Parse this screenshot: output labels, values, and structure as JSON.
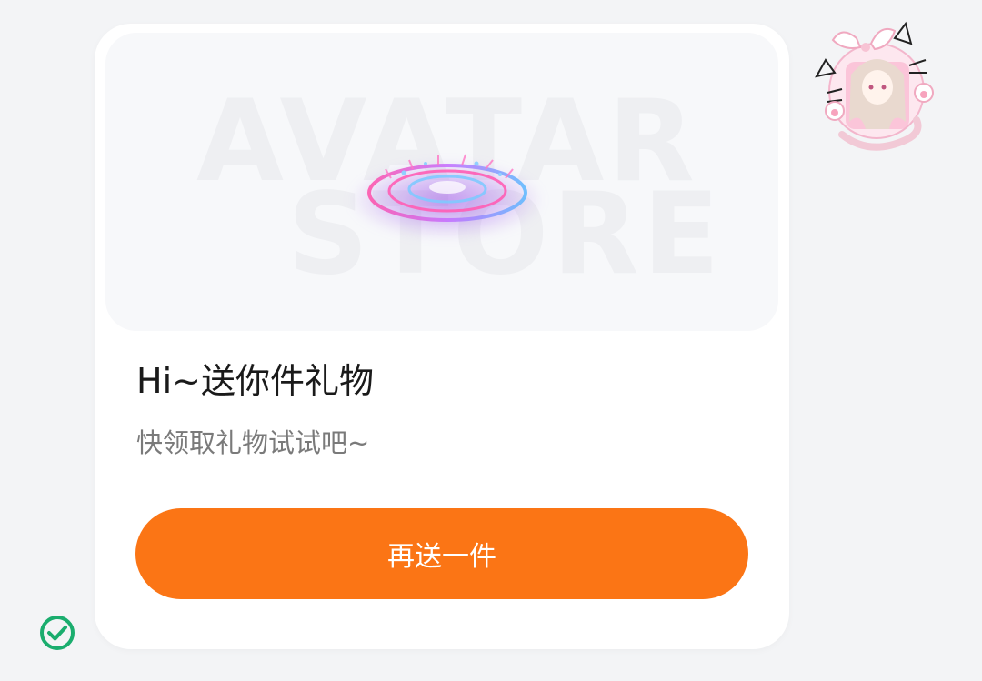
{
  "banner": {
    "watermark_line1": "AVATAR",
    "watermark_line2": "STORE",
    "image_icon": "glowing-magic-circle"
  },
  "gift": {
    "title": "Hi~送你件礼物",
    "subtitle": "快领取礼物试试吧~",
    "button_label": "再送一件"
  },
  "avatar": {
    "icon": "anime-cat-girl-avatar"
  },
  "status": {
    "icon": "check-circle-icon"
  },
  "colors": {
    "accent": "#fb7515",
    "check": "#1aad6e",
    "page_bg": "#f3f4f6",
    "card_bg": "#ffffff"
  }
}
